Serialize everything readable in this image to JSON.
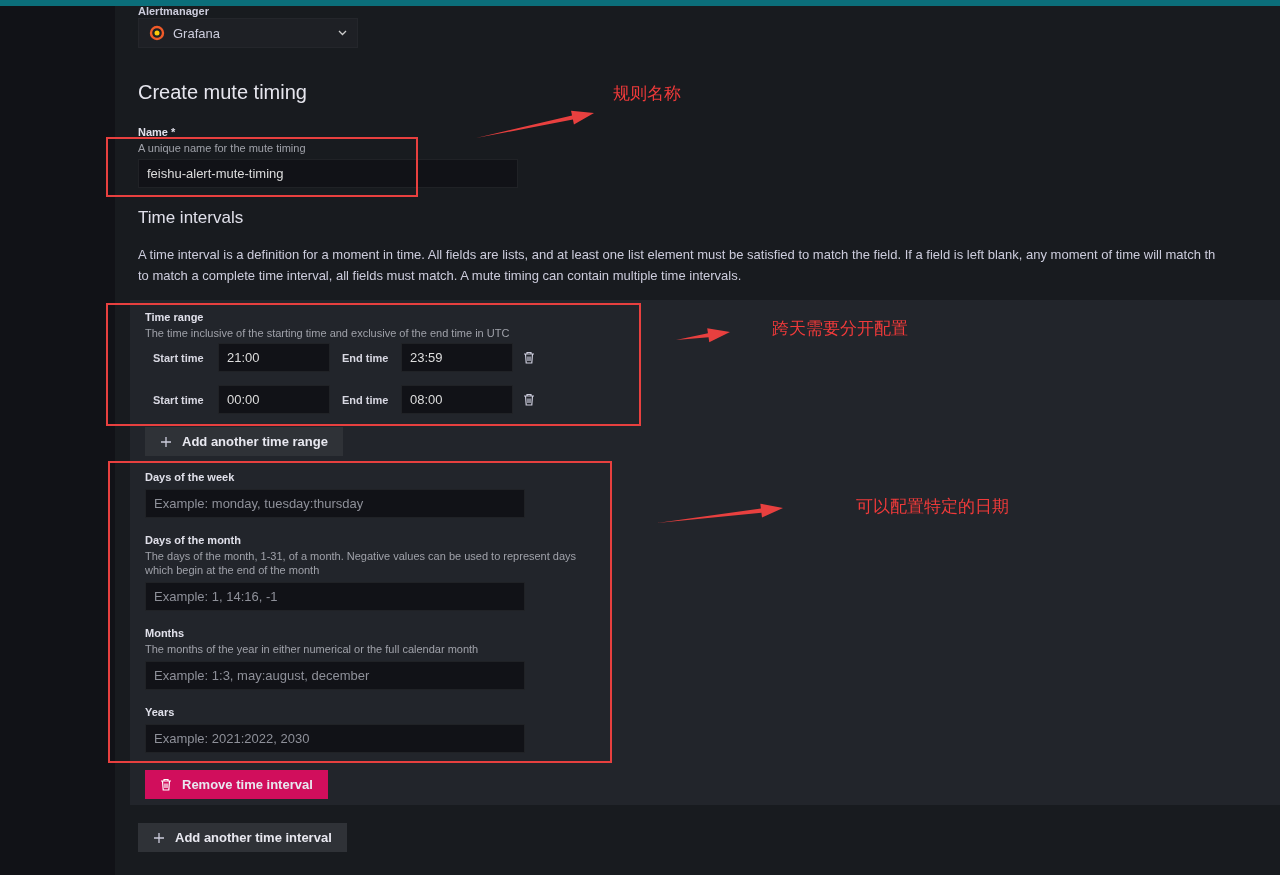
{
  "alertmanager": {
    "label": "Alertmanager",
    "value": "Grafana"
  },
  "title": "Create mute timing",
  "name_field": {
    "label": "Name *",
    "description": "A unique name for the mute timing",
    "value": "feishu-alert-mute-timing"
  },
  "time_intervals": {
    "heading": "Time intervals",
    "paragraph_lines": [
      "A time interval is a definition for a moment in time. All fields are lists, and at least one list element must be satisfied to match the field. If a field is left blank, any moment of time will match th",
      "to match a complete time interval, all fields must match. A mute timing can contain multiple time intervals."
    ],
    "time_range": {
      "label": "Time range",
      "description": "The time inclusive of the starting time and exclusive of the end time in UTC",
      "rows": [
        {
          "start_label": "Start time",
          "start": "21:00",
          "end_label": "End time",
          "end": "23:59"
        },
        {
          "start_label": "Start time",
          "start": "00:00",
          "end_label": "End time",
          "end": "08:00"
        }
      ],
      "add_button": "Add another time range"
    },
    "fields": [
      {
        "label": "Days of the week",
        "placeholder": "Example: monday, tuesday:thursday"
      },
      {
        "label": "Days of the month",
        "description": "The days of the month, 1-31, of a month. Negative values can be used to represent days which begin at the end of the month",
        "placeholder": "Example: 1, 14:16, -1"
      },
      {
        "label": "Months",
        "description": "The months of the year in either numerical or the full calendar month",
        "placeholder": "Example: 1:3, may:august, december"
      },
      {
        "label": "Years",
        "placeholder": "Example: 2021:2022, 2030"
      }
    ],
    "remove_button": "Remove time interval"
  },
  "add_interval_button": "Add another time interval",
  "annotations": [
    {
      "text": "规则名称"
    },
    {
      "text": "跨天需要分开配置"
    },
    {
      "text": "可以配置特定的日期"
    }
  ]
}
